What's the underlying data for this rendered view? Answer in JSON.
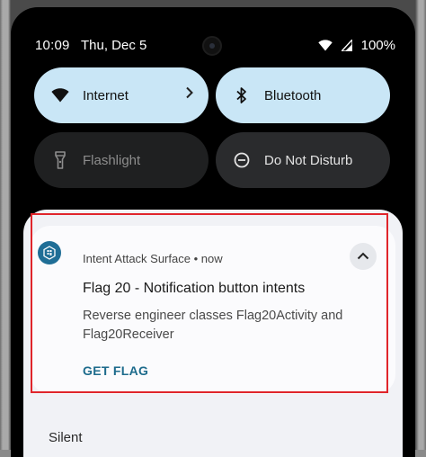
{
  "status_bar": {
    "time": "10:09",
    "date": "Thu, Dec 5",
    "battery": "100%",
    "icons": [
      "wifi-icon",
      "cell-signal-icon"
    ]
  },
  "quick_settings": {
    "tiles": [
      {
        "label": "Internet",
        "icon": "wifi-icon",
        "state": "on",
        "has_chevron": true
      },
      {
        "label": "Bluetooth",
        "icon": "bluetooth-icon",
        "state": "on"
      },
      {
        "label": "Flashlight",
        "icon": "flashlight-icon",
        "state": "off"
      },
      {
        "label": "Do Not Disturb",
        "icon": "do-not-disturb-icon",
        "state": "off"
      }
    ]
  },
  "notification": {
    "app_name": "Intent Attack Surface",
    "time": "now",
    "meta": "Intent Attack Surface • now",
    "title": "Flag 20 - Notification button intents",
    "body": "Reverse engineer classes Flag20Activity and Flag20Receiver",
    "action_label": "GET FLAG",
    "highlight_color": "#e0252b"
  },
  "section": {
    "silent_label": "Silent"
  },
  "colors": {
    "tile_on": "#c9e6f6",
    "tile_off": "#2a2b2d",
    "shade_bg": "#f1f2f6",
    "action": "#1d6b8c"
  }
}
